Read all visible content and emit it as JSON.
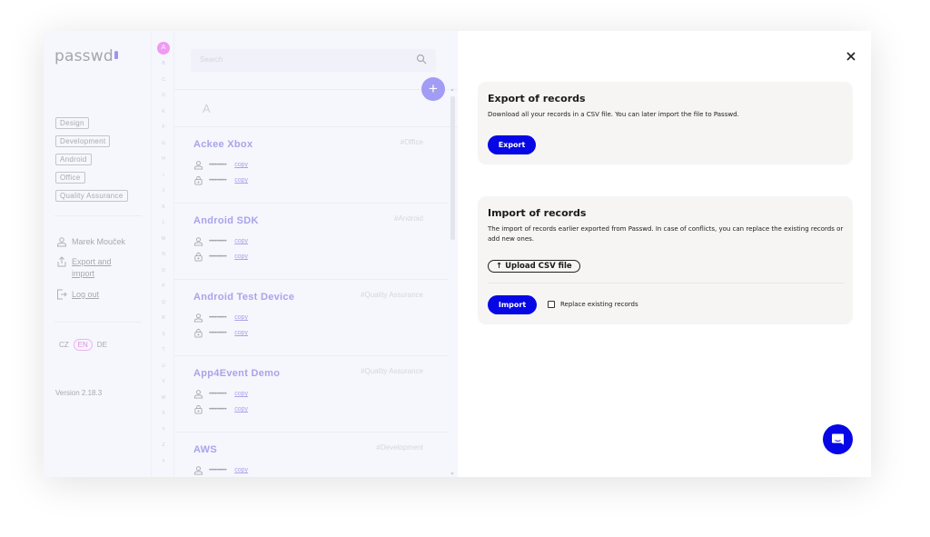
{
  "app": {
    "logo": "passwd",
    "tags": [
      "Design",
      "Development",
      "Android",
      "Office",
      "Quality Assurance"
    ],
    "user_menu": {
      "user_name": "Marek Mouček",
      "export_import_line1": "Export and",
      "export_import_line2": "import",
      "logout": "Log out"
    },
    "languages": [
      "CZ",
      "EN",
      "DE"
    ],
    "active_language": "EN",
    "version": "Version 2.18.3",
    "alphabet_active": "A",
    "alphabet": [
      "B",
      "C",
      "D",
      "E",
      "F",
      "G",
      "H",
      "I",
      "J",
      "K",
      "L",
      "M",
      "N",
      "O",
      "P",
      "Q",
      "R",
      "S",
      "T",
      "U",
      "V",
      "W",
      "X",
      "Y",
      "Z",
      "#"
    ],
    "search": {
      "placeholder": "Search"
    },
    "add_label": "+",
    "section_letter": "A",
    "records": [
      {
        "name": "Ackee Xbox",
        "tag": "#Office",
        "username": "••••••••••••",
        "password": "••••••••••••",
        "copy": "copy"
      },
      {
        "name": "Android SDK",
        "tag": "#Android",
        "username": "••••••••••••",
        "password": "••••••••••••",
        "copy": "copy"
      },
      {
        "name": "Android Test Device",
        "tag": "#Quality Assurance",
        "username": "••••••••••••",
        "password": "••••••••••••",
        "copy": "copy"
      },
      {
        "name": "App4Event Demo",
        "tag": "#Quality Assurance",
        "username": "••••••••••••",
        "password": "••••••••••••",
        "copy": "copy"
      },
      {
        "name": "AWS",
        "tag": "#Development",
        "username": "••••••••••••",
        "password": "••••••••••••",
        "copy": "copy"
      }
    ]
  },
  "panel": {
    "export": {
      "title": "Export of records",
      "description": "Download all your records in a CSV file. You can later import the file to Passwd.",
      "button": "Export"
    },
    "import": {
      "title": "Import of records",
      "description": "The import of records earlier exported from Passwd. In case of conflicts, you can replace the existing records or add new ones.",
      "upload_button": "Upload CSV file",
      "button": "Import",
      "checkbox_label": "Replace existing records",
      "checkbox_checked": false
    }
  },
  "colors": {
    "primary": "#0606e6",
    "accent_soft": "#a29cf4",
    "lang_active": "#ef9af3"
  }
}
